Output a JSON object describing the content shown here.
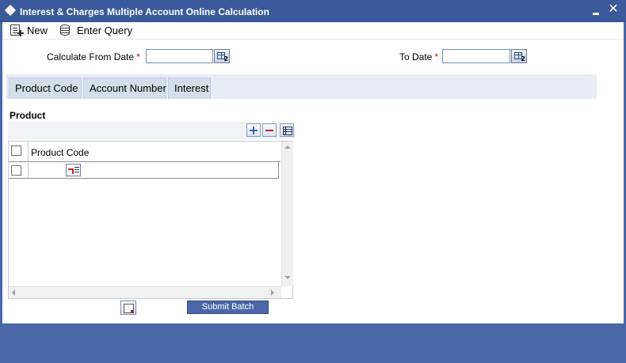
{
  "window": {
    "title": "Interest & Charges Multiple Account Online Calculation",
    "minimize_label": "",
    "close_label": "✕"
  },
  "toolbar": {
    "new_label": "New",
    "enter_query_label": "Enter Query"
  },
  "form": {
    "calculate_from_date": {
      "label": "Calculate From Date",
      "required_mark": "*",
      "value": ""
    },
    "to_date": {
      "label": "To Date",
      "required_mark": "*",
      "value": ""
    },
    "calendar_button_text": "2"
  },
  "tabs": [
    {
      "label": "Product Code"
    },
    {
      "label": "Account Number"
    },
    {
      "label": "Interest"
    }
  ],
  "product_section": {
    "heading": "Product",
    "grid": {
      "columns": [
        "Product Code"
      ],
      "rows": [
        {
          "product_code": ""
        }
      ]
    }
  },
  "footer": {
    "submit_batch_label": "Submit Batch"
  },
  "colors": {
    "frame": "#4a67a8",
    "titlebar": "#3a5a9c",
    "required": "#cc0000",
    "tab_bg": "#d5ddea"
  }
}
